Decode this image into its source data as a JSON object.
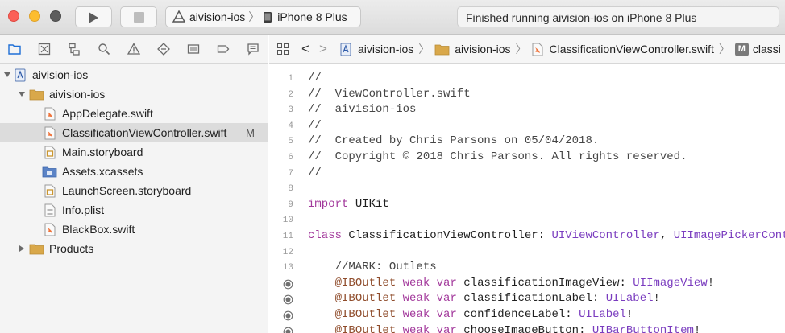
{
  "colors": {
    "accent": "#1e6fd6",
    "keyword": "#a2389b",
    "type": "#7a3cbf",
    "attribute": "#8f4c2b",
    "comment": "#454545"
  },
  "toolbar": {
    "scheme_project": "aivision-ios",
    "scheme_separator": "〉",
    "scheme_device": "iPhone 8 Plus",
    "status": "Finished running aivision-ios on iPhone 8 Plus"
  },
  "navigator": {
    "tabs": [
      "folder-icon",
      "source-control-icon",
      "hierarchy-icon",
      "search-icon",
      "warning-icon",
      "test-icon",
      "debug-icon",
      "breakpoint-icon",
      "report-icon"
    ],
    "items": [
      {
        "label": "aivision-ios",
        "icon": "project-icon",
        "status": ""
      },
      {
        "label": "aivision-ios",
        "icon": "folder-icon",
        "status": ""
      },
      {
        "label": "AppDelegate.swift",
        "icon": "swift-file-icon",
        "status": ""
      },
      {
        "label": "ClassificationViewController.swift",
        "icon": "swift-file-icon",
        "status": "M"
      },
      {
        "label": "Main.storyboard",
        "icon": "storyboard-icon",
        "status": ""
      },
      {
        "label": "Assets.xcassets",
        "icon": "assets-icon",
        "status": ""
      },
      {
        "label": "LaunchScreen.storyboard",
        "icon": "storyboard-icon",
        "status": ""
      },
      {
        "label": "Info.plist",
        "icon": "plist-icon",
        "status": ""
      },
      {
        "label": "BlackBox.swift",
        "icon": "swift-file-icon",
        "status": ""
      },
      {
        "label": "Products",
        "icon": "folder-icon",
        "status": ""
      }
    ]
  },
  "jumpbar": {
    "back": "<",
    "forward": ">",
    "separator": "〉",
    "project": "aivision-ios",
    "group": "aivision-ios",
    "file": "ClassificationViewController.swift",
    "symbol_badge": "M",
    "symbol": "classi"
  },
  "editor": {
    "lines": [
      {
        "n": "1",
        "t": "//"
      },
      {
        "n": "2",
        "t": "//  ViewController.swift"
      },
      {
        "n": "3",
        "t": "//  aivision-ios"
      },
      {
        "n": "4",
        "t": "//"
      },
      {
        "n": "5",
        "t": "//  Created by Chris Parsons on 05/04/2018."
      },
      {
        "n": "6",
        "t": "//  Copyright © 2018 Chris Parsons. All rights reserved."
      },
      {
        "n": "7",
        "t": "//"
      },
      {
        "n": "8",
        "t": ""
      },
      {
        "n": "9",
        "t": "import UIKit"
      },
      {
        "n": "10",
        "t": ""
      },
      {
        "n": "11",
        "t": "class ClassificationViewController: UIViewController, UIImagePickerCont"
      },
      {
        "n": "12",
        "t": ""
      },
      {
        "n": "13",
        "t": "    //MARK: Outlets"
      },
      {
        "n": "",
        "t": "    @IBOutlet weak var classificationImageView: UIImageView!"
      },
      {
        "n": "",
        "t": "    @IBOutlet weak var classificationLabel: UILabel!"
      },
      {
        "n": "",
        "t": "    @IBOutlet weak var confidenceLabel: UILabel!"
      },
      {
        "n": "",
        "t": "    @IBOutlet weak var chooseImageButton: UIBarButtonItem!"
      }
    ],
    "tokens": {
      "import_kw": "import",
      "import_mod": " UIKit",
      "class_kw": "class",
      "class_name": " ClassificationViewController: ",
      "class_super": "UIViewController",
      "class_comma": ", ",
      "class_proto": "UIImagePickerCont",
      "outlet_attr": "@IBOutlet",
      "outlet_kw": " weak var",
      "outlets": [
        {
          "name": " classificationImageView: ",
          "type": "UIImageView",
          "bang": "!"
        },
        {
          "name": " classificationLabel: ",
          "type": "UILabel",
          "bang": "!"
        },
        {
          "name": " confidenceLabel: ",
          "type": "UILabel",
          "bang": "!"
        },
        {
          "name": " chooseImageButton: ",
          "type": "UIBarButtonItem",
          "bang": "!"
        }
      ]
    }
  }
}
